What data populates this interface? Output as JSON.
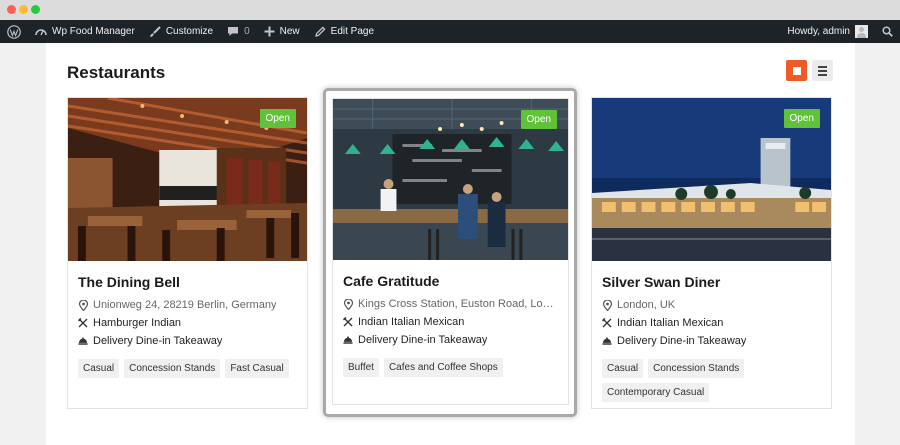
{
  "admin_bar": {
    "site_menu": "Wp Food Manager",
    "customize": "Customize",
    "comments_count": "0",
    "new": "New",
    "edit_page": "Edit Page",
    "greeting": "Howdy, admin"
  },
  "page": {
    "title": "Restaurants"
  },
  "colors": {
    "accent": "#f05a28",
    "open_badge": "#5fc238",
    "admin_bar": "#1d2327"
  },
  "restaurants": [
    {
      "name": "The Dining Bell",
      "status": "Open",
      "address": "Unionweg 24, 28219 Berlin, Germany",
      "cuisines": "Hamburger Indian",
      "services": "Delivery Dine-in Takeaway",
      "tags": [
        "Casual",
        "Concession Stands",
        "Fast Casual"
      ]
    },
    {
      "name": "Cafe Gratitude",
      "status": "Open",
      "address": "Kings Cross Station, Euston Road, London…",
      "cuisines": "Indian Italian Mexican",
      "services": "Delivery Dine-in Takeaway",
      "tags": [
        "Buffet",
        "Cafes and Coffee Shops"
      ]
    },
    {
      "name": "Silver Swan Diner",
      "status": "Open",
      "address": "London, UK",
      "cuisines": "Indian Italian Mexican",
      "services": "Delivery Dine-in Takeaway",
      "tags": [
        "Casual",
        "Concession Stands",
        "Contemporary Casual"
      ]
    }
  ]
}
